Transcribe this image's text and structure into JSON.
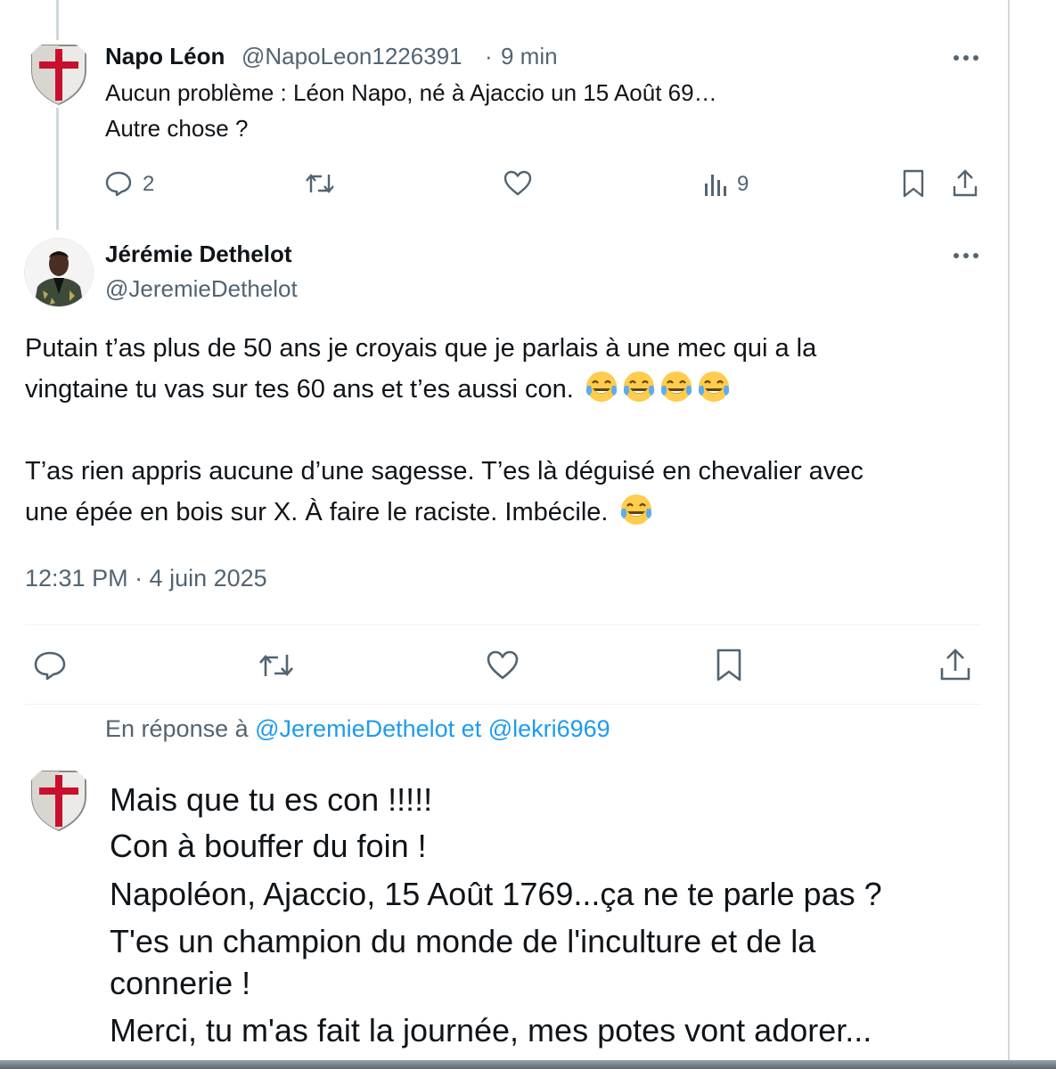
{
  "tweet1": {
    "author_name": "Napo Léon",
    "author_handle": "@NapoLeon1226391",
    "separator": "·",
    "time": "9 min",
    "line1": "Aucun problème : Léon Napo, né à Ajaccio un 15 Août 69…",
    "line2": "Autre chose ?",
    "reply_count": "2",
    "view_count": "9",
    "avatar_icon": "templar-shield-icon"
  },
  "tweet2": {
    "author_name": "Jérémie Dethelot",
    "author_handle": "@JeremieDethelot",
    "para1_line1": "Putain t’as plus de 50 ans je croyais que je parlais à une mec qui a la",
    "para1_line2": "vingtaine tu vas sur tes 60 ans et t’es aussi con.",
    "para2_line1": "T’as rien appris aucune d’une sagesse. T’es là déguisé en chevalier avec",
    "para2_line2": "une épée en bois sur X. À faire le raciste. Imbécile.",
    "emoji_name": "face-with-tears-of-joy-emoji",
    "timestamp": "12:31 PM · 4 juin 2025"
  },
  "reply": {
    "prefix": "En réponse à",
    "mention1": "@JeremieDethelot",
    "conjunction": "et",
    "mention2": "@lekri6969",
    "lines": [
      "Mais que tu es con !!!!!",
      "Con à bouffer du foin !",
      "Napoléon, Ajaccio, 15 Août 1769...ça ne te parle pas ?",
      "T'es un champion du monde de l'inculture et de la",
      "connerie !",
      "Merci, tu m'as fait la journée, mes potes vont adorer..."
    ]
  },
  "colors": {
    "text": "#0f1419",
    "secondary": "#536471",
    "link": "#1d9bf0",
    "templar_red": "#c8102e"
  }
}
